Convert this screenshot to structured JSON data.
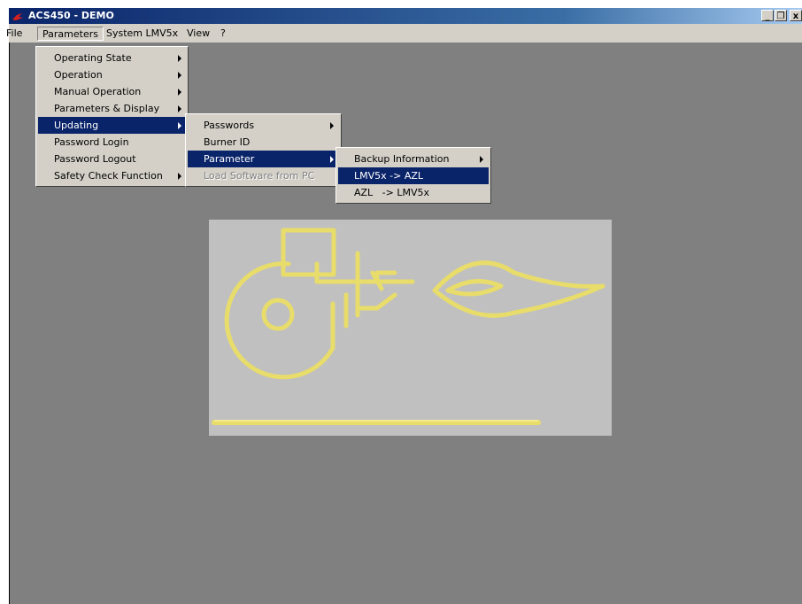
{
  "window": {
    "title": "ACS450 - DEMO"
  },
  "title_buttons": {
    "minimize": "_",
    "restore": "❐",
    "close": "x"
  },
  "menubar": {
    "items": [
      {
        "label": "File"
      },
      {
        "label": "Parameters",
        "open": true
      },
      {
        "label": "System LMV5x"
      },
      {
        "label": "View"
      },
      {
        "label": "?"
      }
    ]
  },
  "parameters_menu": {
    "items": [
      {
        "label": "Operating State",
        "submenu": true
      },
      {
        "label": "Operation",
        "submenu": true
      },
      {
        "label": "Manual Operation",
        "submenu": true
      },
      {
        "label": "Parameters & Display",
        "submenu": true
      },
      {
        "label": "Updating",
        "submenu": true,
        "highlighted": true
      },
      {
        "label": "Password Login",
        "submenu": false
      },
      {
        "label": "Password Logout",
        "submenu": false
      },
      {
        "label": "Safety Check Function",
        "submenu": true
      }
    ]
  },
  "updating_menu": {
    "items": [
      {
        "label": "Passwords",
        "submenu": true
      },
      {
        "label": "Burner ID",
        "submenu": false
      },
      {
        "label": "Parameter",
        "submenu": true,
        "highlighted": true
      },
      {
        "label": "Load Software from PC",
        "submenu": false,
        "disabled": true
      }
    ]
  },
  "parameter_menu": {
    "items": [
      {
        "label": "Backup Information",
        "submenu": true
      },
      {
        "label": "LMV5x -> AZL",
        "submenu": false,
        "highlighted": true
      },
      {
        "label": "AZL   -> LMV5x",
        "submenu": false
      }
    ]
  },
  "colors": {
    "highlight": "#0a246a",
    "menu_bg": "#d4d0c8",
    "workspace": "#808080",
    "logo_yellow": "#e8dc6a",
    "logo_bg": "#c0c0c0"
  },
  "icons": {
    "app": "flame-icon",
    "logo": "burner-logo"
  }
}
